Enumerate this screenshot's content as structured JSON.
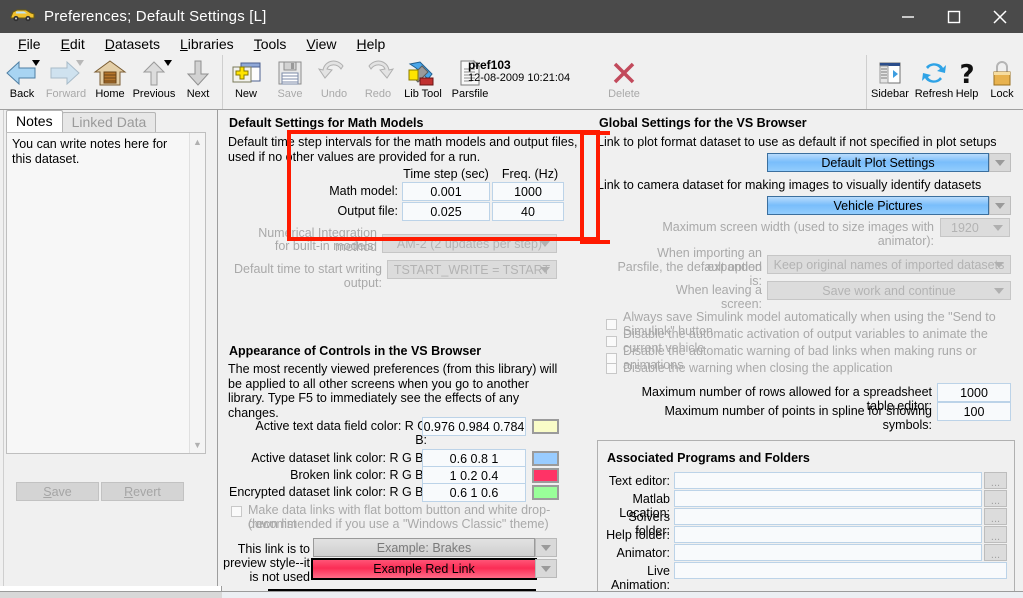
{
  "window": {
    "title": "Preferences;  Default Settings [L]",
    "icon": "car-icon",
    "controls": [
      {
        "name": "minimize-button",
        "glyph": "minimize-icon"
      },
      {
        "name": "maximize-button",
        "glyph": "maximize-icon"
      },
      {
        "name": "close-button",
        "glyph": "close-icon"
      }
    ]
  },
  "menubar": {
    "items": [
      {
        "label": "File",
        "accel": "F"
      },
      {
        "label": "Edit",
        "accel": "E"
      },
      {
        "label": "Datasets",
        "accel": "D"
      },
      {
        "label": "Libraries",
        "accel": "L"
      },
      {
        "label": "Tools",
        "accel": "T"
      },
      {
        "label": "View",
        "accel": "V"
      },
      {
        "label": "Help",
        "accel": "H"
      }
    ]
  },
  "toolbar": {
    "items": [
      {
        "label": "Back",
        "icon": "back-arrow-icon",
        "disabled": false,
        "has_dropdown": true
      },
      {
        "label": "Forward",
        "icon": "forward-arrow-icon",
        "disabled": true,
        "has_dropdown": true
      },
      {
        "label": "Home",
        "icon": "home-icon",
        "disabled": false,
        "has_dropdown": false
      },
      {
        "label": "Previous",
        "icon": "up-arrow-icon",
        "disabled": false,
        "has_dropdown": true
      },
      {
        "label": "Next",
        "icon": "down-arrow-icon",
        "disabled": false,
        "has_dropdown": false
      },
      {
        "label": "New",
        "icon": "new-dataset-icon",
        "disabled": false,
        "has_dropdown": false
      },
      {
        "label": "Save",
        "icon": "floppy-disk-icon",
        "disabled": true,
        "has_dropdown": false
      },
      {
        "label": "Undo",
        "icon": "undo-arrow-icon",
        "disabled": true,
        "has_dropdown": false
      },
      {
        "label": "Redo",
        "icon": "redo-arrow-icon",
        "disabled": true,
        "has_dropdown": false
      },
      {
        "label": "Lib Tool",
        "icon": "wrench-icon",
        "disabled": false,
        "has_dropdown": false
      },
      {
        "label": "Parsfile",
        "icon": "document-icon",
        "disabled": false,
        "has_dropdown": false
      },
      {
        "label": "Delete",
        "icon": "red-x-icon",
        "disabled": true,
        "has_dropdown": false
      }
    ],
    "right_items": [
      {
        "label": "Sidebar",
        "icon": "sidebar-icon"
      },
      {
        "label": "Refresh",
        "icon": "refresh-icon"
      },
      {
        "label": "Help",
        "icon": "question-mark-icon"
      },
      {
        "label": "Lock",
        "icon": "padlock-icon"
      }
    ],
    "parsfile": {
      "name": "pref103",
      "date": "12-08-2009 10:21:04"
    }
  },
  "left_panel": {
    "tabs": [
      {
        "label": "Notes",
        "active": true
      },
      {
        "label": "Linked Data",
        "active": false
      }
    ],
    "notes_text": "You can write notes here for this dataset.",
    "buttons": [
      {
        "label": "Save",
        "accel": "S",
        "disabled": true
      },
      {
        "label": "Revert",
        "accel": "R",
        "disabled": true
      }
    ]
  },
  "center_panel": {
    "math_models": {
      "heading": "Default Settings for Math Models",
      "description": "Default time step intervals for the math models and output files, used if no other values are provided for a run.",
      "table": {
        "columns": [
          "Time step (sec)",
          "Freq. (Hz)"
        ],
        "rows": [
          {
            "label": "Math model:",
            "timestep": "0.001",
            "freq": "1000"
          },
          {
            "label": "Output file:",
            "timestep": "0.025",
            "freq": "40"
          }
        ]
      },
      "integration_label_line1": "Numerical Integration method",
      "integration_label_line2": "for built-in models:",
      "integration_value": "AM-2 (2 updates per step)",
      "tstart_label": "Default time to start writing output:",
      "tstart_value": "TSTART_WRITE = TSTART"
    },
    "appearance": {
      "heading": "Appearance of Controls in the VS Browser",
      "description": "The most recently viewed preferences (from this library) will be applied to all other screens when you go to another library. Type F5 to immediately see the effects of any changes.",
      "colors": [
        {
          "label": "Active text data field color: R G B:",
          "value": "0.976 0.984 0.784",
          "swatch": "#f9fcc8"
        },
        {
          "label": "Active dataset link color: R G B:",
          "value": "0.6 0.8 1",
          "swatch": "#99ccff"
        },
        {
          "label": "Broken link color: R G B:",
          "value": "1 0.2 0.4",
          "swatch": "#ff3366"
        },
        {
          "label": "Encrypted dataset link color: R G B:",
          "value": "0.6 1 0.6",
          "swatch": "#99ff99"
        }
      ],
      "flat_checkbox_line1": "Make data links with flat bottom button and white drop-down list",
      "flat_checkbox_line2": "(recommended if you use a \"Windows Classic\" theme)",
      "preview_label_line1": "This link is to",
      "preview_label_line2": "preview style--it",
      "preview_label_line3": "is not  used",
      "preview_disabled_link": "Example: Brakes",
      "preview_red_link": "Example Red Link"
    }
  },
  "right_panel": {
    "global": {
      "heading": "Global Settings for the VS Browser",
      "plot_format_label": "Link to plot format dataset to use as default if not specified in plot setups",
      "plot_format_value": "Default Plot Settings",
      "camera_label": "Link to camera dataset for making images to visually identify datasets",
      "camera_value": "Vehicle Pictures",
      "max_width_label": "Maximum screen width (used to size images with animator):",
      "max_width_value": "1920",
      "import_label_line1": "When importing an expanded",
      "import_label_line2": "Parsfile, the default option is:",
      "import_value": "Keep original names of imported datasets",
      "leaving_label": "When leaving a screen:",
      "leaving_value": "Save work and continue",
      "checkboxes": [
        {
          "label": "Always save Simulink model automatically when using the \"Send to Simulink\" button",
          "checked": false
        },
        {
          "label": "Disable the automatic activation of output variables to animate the current vehicle",
          "checked": false
        },
        {
          "label": "Disable the automatic warning of bad links when making runs or animations",
          "checked": false
        },
        {
          "label": "Disable the warning when closing the application",
          "checked": false
        }
      ],
      "numeric_rows": [
        {
          "label": "Maximum number of rows allowed for a spreadsheet table editor:",
          "value": "1000"
        },
        {
          "label": "Maximum number of points in spline for showing symbols:",
          "value": "100"
        }
      ]
    },
    "associated": {
      "heading": "Associated Programs and Folders",
      "rows": [
        {
          "label": "Text editor:",
          "value": "",
          "has_browse": true
        },
        {
          "label": "Matlab Location:",
          "value": "",
          "has_browse": true
        },
        {
          "label": "Solvers folder:",
          "value": "",
          "has_browse": true
        },
        {
          "label": "Help folder:",
          "value": "",
          "has_browse": true
        },
        {
          "label": "Animator:",
          "value": "",
          "has_browse": true
        },
        {
          "label": "Live Animation:",
          "value": "",
          "has_browse": false
        }
      ],
      "browse_label": "..."
    }
  },
  "annotations": {
    "color": "#ff1a00",
    "boxes": [
      {
        "name": "math-model-timestep-highlight"
      },
      {
        "name": "global-settings-left-highlight"
      }
    ]
  },
  "palette": {
    "titlebar_bg": "#4a4a4a",
    "window_bg": "#f0f0f0",
    "field_border": "#bcd3e8",
    "field_bg": "#f8fafc",
    "blue_link": "#79bdfb",
    "red_link": "#fb2d55",
    "annotation_red": "#ff1a00"
  }
}
